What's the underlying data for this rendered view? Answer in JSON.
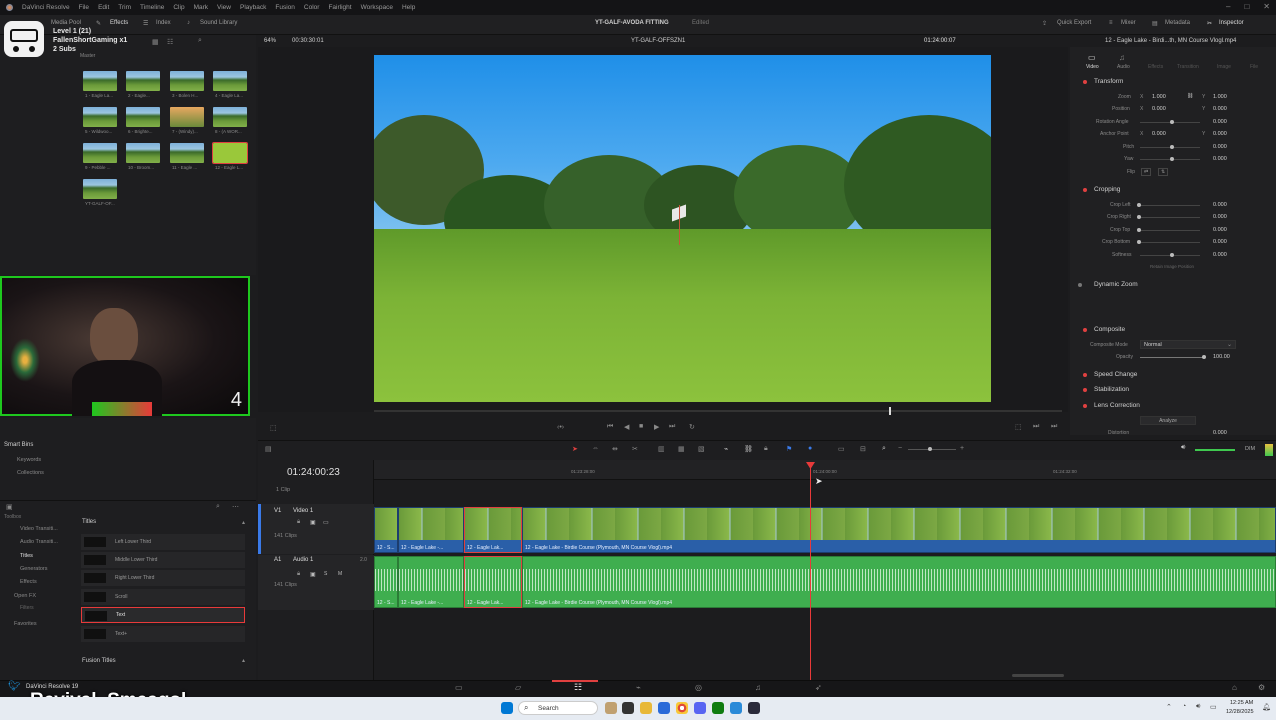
{
  "menu": [
    "DaVinci Resolve",
    "File",
    "Edit",
    "Trim",
    "Timeline",
    "Clip",
    "Mark",
    "View",
    "Playback",
    "Fusion",
    "Color",
    "Fairlight",
    "Workspace",
    "Help"
  ],
  "toolbar": {
    "media_pool": "Media Pool",
    "effects": "Effects",
    "index": "Index",
    "sound_library": "Sound Library",
    "project_title": "YT-GALF-AVODA FITTING",
    "project_status": "Edited",
    "quick_export": "Quick Export",
    "mixer": "Mixer",
    "metadata": "Metadata",
    "inspector": "Inspector"
  },
  "overlay": {
    "level": "Level 1 (21)",
    "channel": "FallenShortGaming x1",
    "subs": "2 Subs",
    "master": "Master",
    "counter": "4",
    "handle": "Revival_Smeagol",
    "resolve_version": "DaVinci Resolve 19"
  },
  "media_thumbs": [
    "1 - Eagle La...",
    "2 - Eagle...",
    "3 - Bolen H...",
    "4 - Eagle La...",
    "5 - Wildwoo...",
    "6 - Brighte...",
    "7 - (Windy)...",
    "8 - (A WOR...",
    "9 - Pebble ...",
    "10 - Broom...",
    "11 - Eagle ...",
    "12 - Eagle L...",
    "YT-GALF-OF..."
  ],
  "viewer_header": {
    "zoom": "64%",
    "source_tc": "00:30:30:01",
    "timeline_name": "YT-GALF-OFFSZN1",
    "record_tc": "01:24:00:07",
    "clip_name": "12 - Eagle Lake - Birdi...th, MN Course Vlogl.mp4"
  },
  "inspector": {
    "tabs": [
      "Video",
      "Audio",
      "Effects",
      "Transition",
      "Image",
      "File"
    ],
    "transform": "Transform",
    "zoom_label": "Zoom",
    "zoom_x": "1.000",
    "zoom_y": "1.000",
    "position_label": "Position",
    "position_x": "0.000",
    "position_y": "0.000",
    "rotation_label": "Rotation Angle",
    "rotation": "0.000",
    "anchor_label": "Anchor Point",
    "anchor_x": "0.000",
    "anchor_y": "0.000",
    "pitch_label": "Pitch",
    "pitch": "0.000",
    "yaw_label": "Yaw",
    "yaw": "0.000",
    "flip_label": "Flip",
    "cropping": "Cropping",
    "crop_left_label": "Crop Left",
    "crop_left": "0.000",
    "crop_right_label": "Crop Right",
    "crop_right": "0.000",
    "crop_top_label": "Crop Top",
    "crop_top": "0.000",
    "crop_bottom_label": "Crop Bottom",
    "crop_bottom": "0.000",
    "softness_label": "Softness",
    "softness": "0.000",
    "retain": "Retain Image Position",
    "dynamic_zoom": "Dynamic Zoom",
    "composite": "Composite",
    "composite_mode_label": "Composite Mode",
    "composite_mode": "Normal",
    "opacity_label": "Opacity",
    "opacity": "100.00",
    "speed_change": "Speed Change",
    "stabilization": "Stabilization",
    "lens_correction": "Lens Correction",
    "analyze": "Analyze",
    "distortion_label": "Distortion",
    "distortion": "0.000"
  },
  "left_lower": {
    "smart_bins": "Smart Bins",
    "keywords": "Keywords",
    "collections": "Collections",
    "toolbox": "Toolbox",
    "tree": [
      "Video Transiti...",
      "Audio Transiti...",
      "Titles",
      "Generators",
      "Effects",
      "Open FX",
      "Filters",
      "Favorites"
    ],
    "titles_header": "Titles",
    "titles": [
      "Left Lower Third",
      "Middle Lower Third",
      "Right Lower Third",
      "Scroll",
      "Text",
      "Text+"
    ],
    "fusion_titles": "Fusion Titles"
  },
  "timeline": {
    "timecode": "01:24:00:23",
    "clip_count": "1 Clip",
    "ruler": [
      "01:23:28:00",
      "01:24:00:00",
      "01:24:32:00"
    ],
    "v1_id": "V1",
    "v1_name": "Video 1",
    "v1_clips": "141 Clips",
    "a1_id": "A1",
    "a1_name": "Audio 1",
    "a1_clips": "141 Clips",
    "a1_level": "2.0",
    "clip_short_1": "12 - S...",
    "clip_short_2": "12 - Eagle Lake -...",
    "clip_short_3": "12 - Eagle Lak...",
    "clip_long": "12 - Eagle Lake - Birdie Course (Plymouth, MN Course Vlogl).mp4",
    "dim": "DIM"
  },
  "taskbar": {
    "search": "Search",
    "time": "12:25 AM",
    "date": "12/28/2025"
  }
}
